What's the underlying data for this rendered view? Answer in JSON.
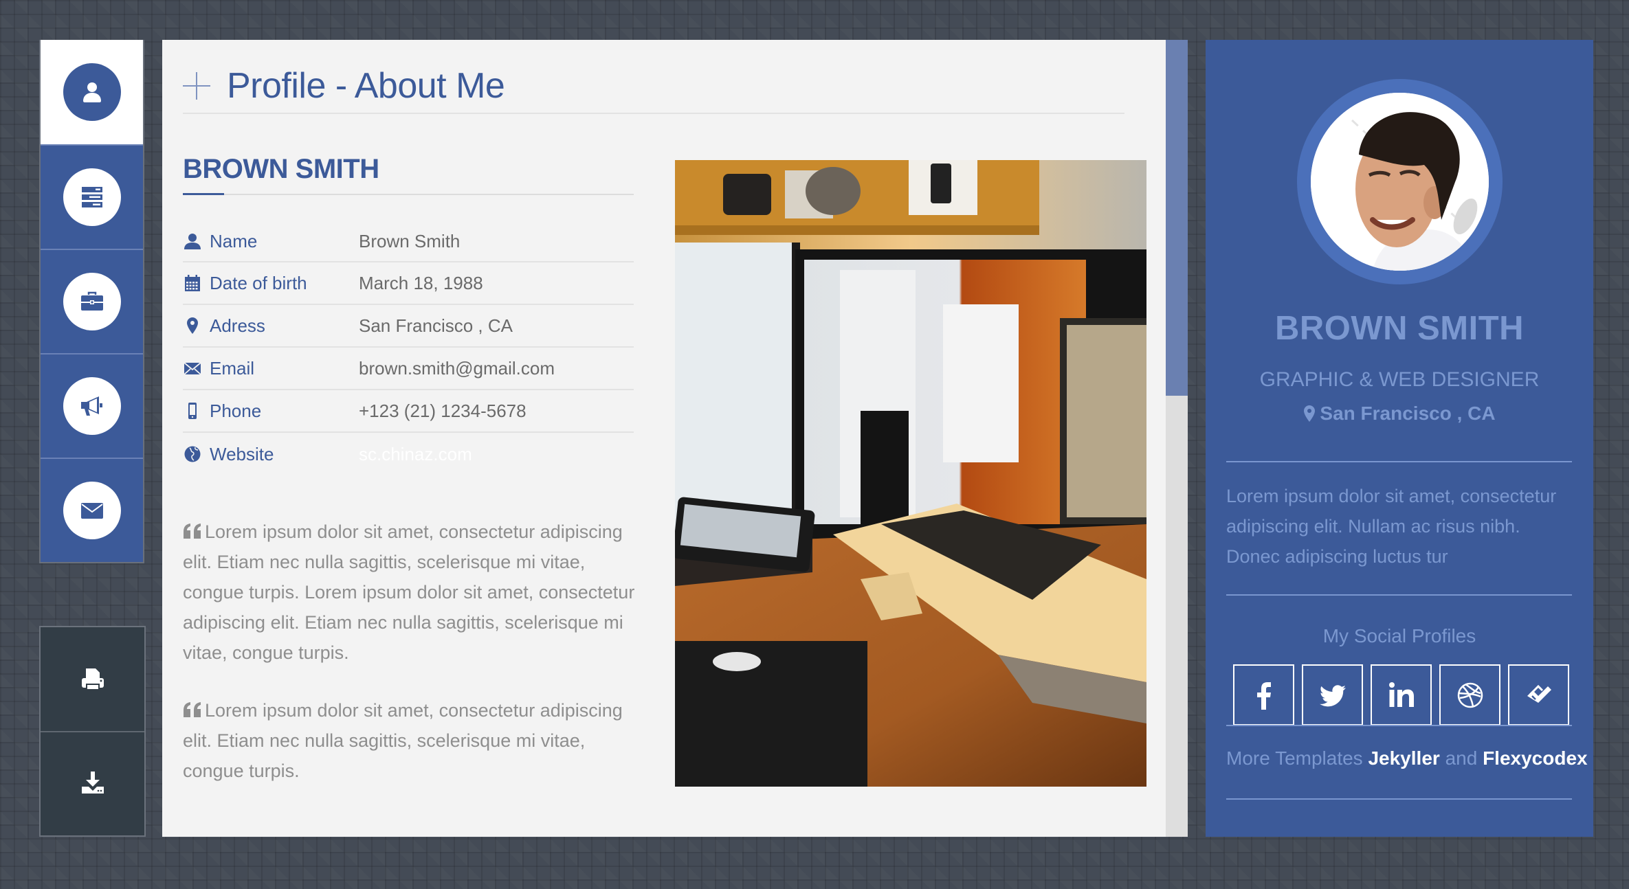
{
  "sidebar": {
    "items": [
      {
        "id": "profile",
        "icon": "user-icon",
        "active": true
      },
      {
        "id": "resume",
        "icon": "server-list-icon",
        "active": false
      },
      {
        "id": "portfolio",
        "icon": "briefcase-icon",
        "active": false
      },
      {
        "id": "announcements",
        "icon": "megaphone-icon",
        "active": false
      },
      {
        "id": "contact",
        "icon": "envelope-icon",
        "active": false
      }
    ],
    "tools": [
      {
        "id": "print",
        "icon": "printer-icon"
      },
      {
        "id": "download",
        "icon": "download-icon"
      }
    ]
  },
  "main": {
    "title": "Profile - About Me",
    "profile_name": "BROWN SMITH",
    "info": [
      {
        "icon": "user-icon",
        "label": "Name",
        "value": "Brown Smith"
      },
      {
        "icon": "calendar-icon",
        "label": "Date of birth",
        "value": "March 18, 1988"
      },
      {
        "icon": "map-marker-icon",
        "label": "Adress",
        "value": "San Francisco , CA"
      },
      {
        "icon": "envelope-icon",
        "label": "Email",
        "value": "brown.smith@gmail.com"
      },
      {
        "icon": "mobile-phone-icon",
        "label": "Phone",
        "value": "+123 (21) 1234-5678"
      },
      {
        "icon": "globe-icon",
        "label": "Website",
        "value": "sc.chinaz.com"
      }
    ],
    "quotes": [
      "Lorem ipsum dolor sit amet, consectetur adipiscing elit. Etiam nec nulla sagittis, scelerisque mi vitae, congue turpis. Lorem ipsum dolor sit amet, consectetur adipiscing elit. Etiam nec nulla sagittis, scelerisque mi vitae, congue turpis.",
      "Lorem ipsum dolor sit amet, consectetur adipiscing elit. Etiam nec nulla sagittis, scelerisque mi vitae, congue turpis."
    ],
    "photo_alt": "Desk workspace with monitors, laptop and tablet"
  },
  "card": {
    "name": "BROWN SMITH",
    "role": "GRAPHIC & WEB DESIGNER",
    "location": "San Francisco , CA",
    "bio": "Lorem ipsum dolor sit amet, consectetur adipiscing elit. Nullam ac risus nibh. Donec adipiscing luctus tur",
    "social_title": "My Social Profiles",
    "social": [
      {
        "name": "facebook",
        "icon": "facebook-icon"
      },
      {
        "name": "twitter",
        "icon": "twitter-icon"
      },
      {
        "name": "linkedin",
        "icon": "linkedin-icon"
      },
      {
        "name": "dribbble",
        "icon": "dribbble-icon"
      },
      {
        "name": "foursquare",
        "icon": "foursquare-icon"
      }
    ],
    "more_prefix": "More Templates",
    "more_link1": "Jekyller",
    "more_and": "and",
    "more_link2": "Flexycodex"
  },
  "colors": {
    "brand_blue": "#3c5a99",
    "card_text": "#7b98d0",
    "avatar_ring": "#4b70ba",
    "panel_bg": "#f3f3f3",
    "page_bg": "#444b56",
    "tool_bg": "#323d46"
  }
}
